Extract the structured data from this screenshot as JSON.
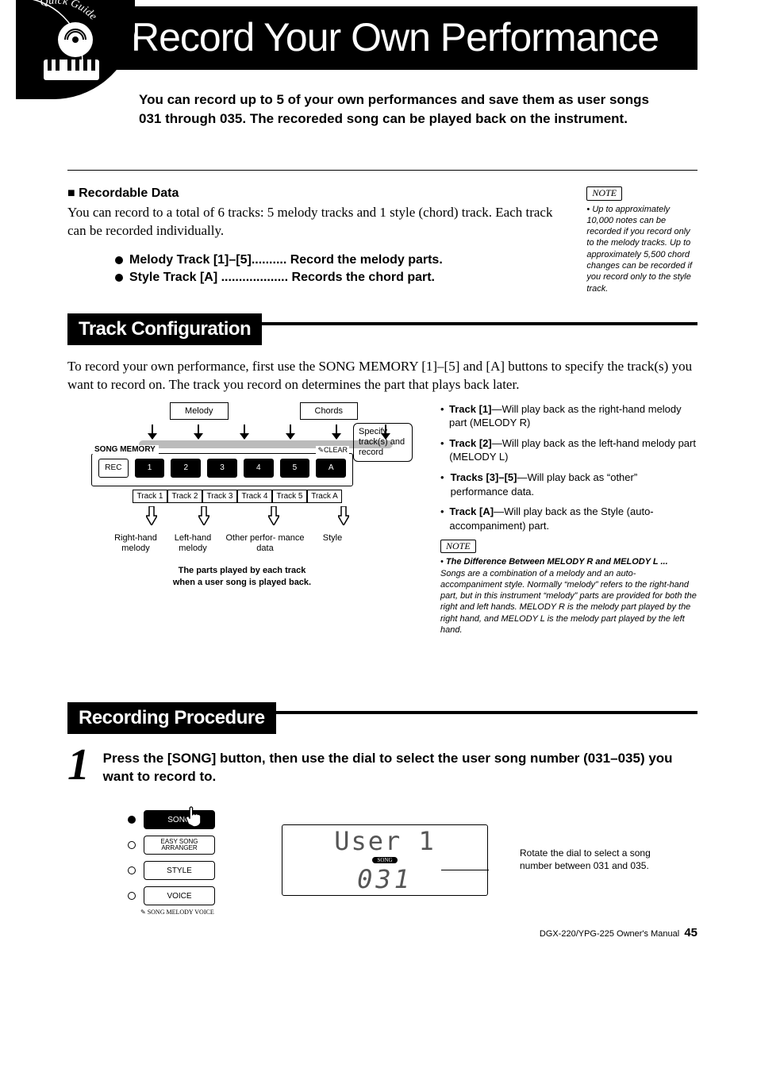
{
  "page_title": "Record Your Own Performance",
  "intro": "You can record up to 5 of your own performances and save them as user songs 031 through 035. The recoreded song can be played back on the instrument.",
  "badge_text": "Quick Guide",
  "recordable": {
    "heading_prefix": "■",
    "heading": "Recordable Data",
    "body": "You can record to a total of 6 tracks: 5 melody tracks and 1 style (chord) track. Each track can be recorded individually.",
    "items": [
      "Melody Track [1]–[5].......... Record the melody parts.",
      "Style Track [A] ................... Records the chord part."
    ]
  },
  "note1": {
    "label": "NOTE",
    "body": "Up to approximately 10,000 notes can be recorded if you record only to the melody tracks. Up to approximately 5,500 chord changes can be recorded if you record only to the style track."
  },
  "section1": {
    "title": "Track Configuration",
    "body": "To record your own performance, first use the SONG MEMORY [1]–[5] and [A] buttons to specify the track(s) you want to record on. The track you record on determines the part that plays back later."
  },
  "diagram": {
    "top_labels": [
      "Melody",
      "Chords"
    ],
    "side_note": "Specify track(s) and record",
    "panel_label": "SONG MEMORY",
    "clear_label": "CLEAR",
    "buttons": [
      "REC",
      "1",
      "2",
      "3",
      "4",
      "5",
      "A"
    ],
    "track_labels": [
      "Track 1",
      "Track 2",
      "Track 3",
      "Track 4",
      "Track 5",
      "Track A"
    ],
    "parts": [
      "Right-hand melody",
      "Left-hand melody",
      "Other perfor-\nmance data",
      "Style"
    ],
    "caption": "The parts played by each track\nwhen a user song is played back."
  },
  "track_desc": [
    {
      "t": "Track [1]",
      "d": "—Will play back as the right-hand melody part (MELODY R)"
    },
    {
      "t": "Track [2]",
      "d": "—Will play back as the left-hand melody part (MELODY L)"
    },
    {
      "t": "Tracks [3]–[5]",
      "d": "—Will play back as “other” performance data."
    },
    {
      "t": "Track [A]",
      "d": "—Will play back as the Style (auto-accompaniment) part."
    }
  ],
  "note2": {
    "label": "NOTE",
    "lead": "The Difference Between MELODY R and MELODY L ...",
    "body": "Songs are a combination of a melody and an auto-accompaniment style. Normally “melody” refers to the right-hand part, but in this instrument “melody” parts are provided for both the right and left hands. MELODY R is the melody part played by the right hand, and MELODY L is the melody part played by the left hand."
  },
  "section2": {
    "title": "Recording Procedure"
  },
  "step1": {
    "num": "1",
    "text": "Press the [SONG] button, then use the dial to select the user song number (031–035) you want to record to."
  },
  "ctrl": {
    "buttons": [
      "SONG",
      "EASY SONG\nARRANGER",
      "STYLE",
      "VOICE"
    ],
    "sub": "SONG MELODY VOICE"
  },
  "lcd": {
    "line1": "User 1",
    "song_tag": "SONG",
    "line2": "031"
  },
  "dial_note": "Rotate the dial to select a song number between 031 and 035.",
  "footer": {
    "manual": "DGX-220/YPG-225  Owner's Manual",
    "page": "45"
  }
}
